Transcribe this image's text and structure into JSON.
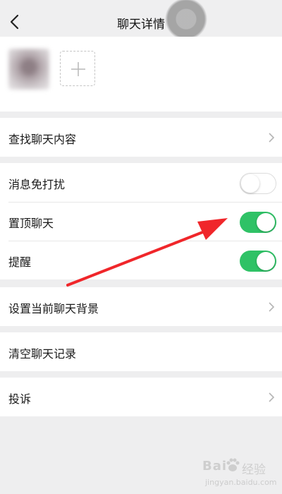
{
  "nav": {
    "title": "聊天详情"
  },
  "rows": {
    "search_history": "查找聊天内容",
    "mute": "消息免打扰",
    "sticky": "置顶聊天",
    "remind": "提醒",
    "set_background": "设置当前聊天背景",
    "clear_history": "清空聊天记录",
    "report": "投诉"
  },
  "toggles": {
    "mute": false,
    "sticky": true,
    "remind": true
  },
  "colors": {
    "toggle_on": "#2fc266",
    "arrow": "#f0262a",
    "background": "#eeeeef"
  },
  "watermark": {
    "brand_bai": "Bai",
    "brand_jingyan": "经验",
    "url": "jingyan.baidu.com"
  }
}
